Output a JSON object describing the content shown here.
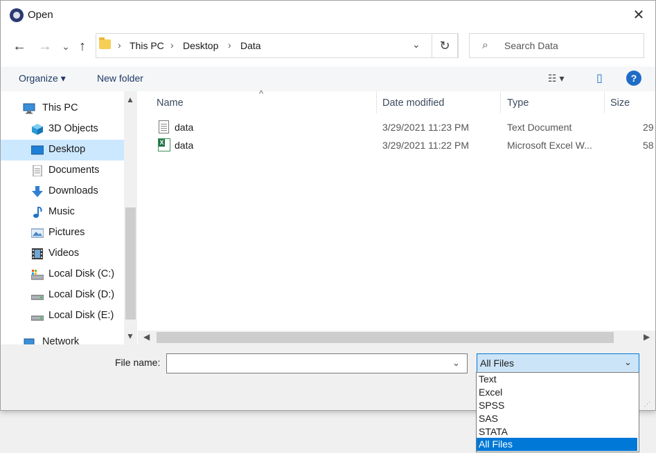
{
  "window": {
    "title": "Open",
    "close": "✕"
  },
  "nav": {
    "back": "←",
    "forward": "→",
    "recent": "⌄",
    "up": "↑"
  },
  "address": {
    "crumbs": [
      "This PC",
      "Desktop",
      "Data"
    ],
    "sep": "›",
    "dropdown": "⌄",
    "refresh": "↻"
  },
  "search": {
    "placeholder": "Search Data",
    "icon": "⌕"
  },
  "toolbar": {
    "organize": "Organize ▾",
    "new_folder": "New folder",
    "view": "☷ ▾",
    "pane": "▯",
    "help": "?"
  },
  "sidebar": {
    "items": [
      {
        "label": "This PC",
        "icon": "pc-icon"
      },
      {
        "label": "3D Objects",
        "icon": "cube-icon"
      },
      {
        "label": "Desktop",
        "icon": "desktop-icon",
        "selected": true
      },
      {
        "label": "Documents",
        "icon": "document-icon"
      },
      {
        "label": "Downloads",
        "icon": "download-icon"
      },
      {
        "label": "Music",
        "icon": "music-icon"
      },
      {
        "label": "Pictures",
        "icon": "picture-icon"
      },
      {
        "label": "Videos",
        "icon": "video-icon"
      },
      {
        "label": "Local Disk (C:)",
        "icon": "disk-icon"
      },
      {
        "label": "Local Disk (D:)",
        "icon": "disk-icon"
      },
      {
        "label": "Local Disk (E:)",
        "icon": "disk-icon"
      },
      {
        "label": "Network",
        "icon": "network-icon"
      }
    ],
    "scroll_up": "▲",
    "scroll_down": "▼"
  },
  "filelist": {
    "columns": [
      "Name",
      "Date modified",
      "Type",
      "Size"
    ],
    "sort_caret": "^",
    "rows": [
      {
        "name": "data",
        "date": "3/29/2021 11:23 PM",
        "type": "Text Document",
        "size": "29",
        "icon": "text-file-icon"
      },
      {
        "name": "data",
        "date": "3/29/2021 11:22 PM",
        "type": "Microsoft Excel W...",
        "size": "58",
        "icon": "excel-file-icon"
      }
    ],
    "scroll_left": "◀",
    "scroll_right": "▶"
  },
  "bottom": {
    "file_name_label": "File name:",
    "file_name_value": "",
    "fn_dropdown": "⌄",
    "file_type_value": "All Files",
    "type_dropdown": "⌄"
  },
  "filetype_options": [
    "Text",
    "Excel",
    "SPSS",
    "SAS",
    "STATA",
    "All Files"
  ],
  "selected_option": "All Files",
  "colors": {
    "accent": "#0078d7",
    "selection": "#cce8ff"
  }
}
